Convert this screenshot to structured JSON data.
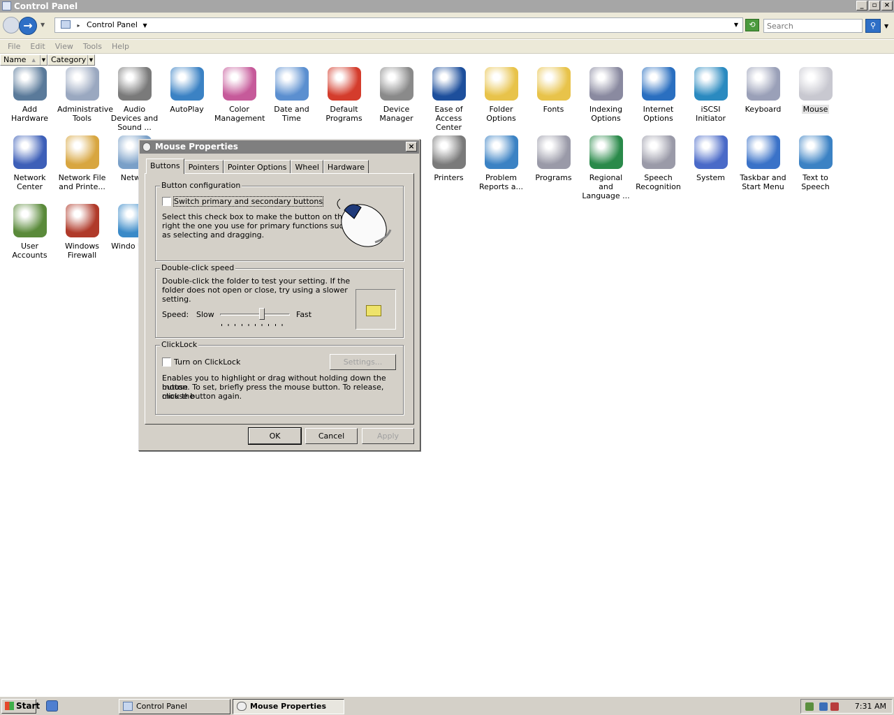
{
  "window": {
    "title": "Control Panel"
  },
  "address": {
    "location": "Control Panel",
    "search_placeholder": "Search"
  },
  "menu": [
    "File",
    "Edit",
    "View",
    "Tools",
    "Help"
  ],
  "columns": [
    "Name",
    "Category"
  ],
  "items": [
    {
      "label": "Add Hardware",
      "icon": "add-hardware-icon"
    },
    {
      "label": "Administrative Tools",
      "icon": "admin-tools-icon"
    },
    {
      "label": "Audio Devices and Sound ...",
      "icon": "speaker-icon"
    },
    {
      "label": "AutoPlay",
      "icon": "autoplay-icon"
    },
    {
      "label": "Color Management",
      "icon": "color-management-icon"
    },
    {
      "label": "Date and Time",
      "icon": "calendar-clock-icon"
    },
    {
      "label": "Default Programs",
      "icon": "default-programs-icon"
    },
    {
      "label": "Device Manager",
      "icon": "device-manager-icon"
    },
    {
      "label": "Ease of Access Center",
      "icon": "ease-of-access-icon"
    },
    {
      "label": "Folder Options",
      "icon": "folder-options-icon"
    },
    {
      "label": "Fonts",
      "icon": "fonts-folder-icon"
    },
    {
      "label": "Indexing Options",
      "icon": "indexing-icon"
    },
    {
      "label": "Internet Options",
      "icon": "globe-document-icon"
    },
    {
      "label": "iSCSI Initiator",
      "icon": "iscsi-globe-icon"
    },
    {
      "label": "Keyboard",
      "icon": "keyboard-icon"
    },
    {
      "label": "Mouse",
      "icon": "mouse-icon"
    },
    {
      "label": "Network Center",
      "icon": "network-icon"
    },
    {
      "label": "Network File and Printe...",
      "icon": "network-file-folder-icon"
    },
    {
      "label": "Networ",
      "icon": "network-list-icon"
    },
    {
      "label": "Printers",
      "icon": "printer-icon"
    },
    {
      "label": "Problem Reports a...",
      "icon": "problem-reports-icon"
    },
    {
      "label": "Programs",
      "icon": "programs-icon"
    },
    {
      "label": "Regional and Language ...",
      "icon": "regional-globe-icon"
    },
    {
      "label": "Speech Recognition",
      "icon": "microphone-icon"
    },
    {
      "label": "System",
      "icon": "system-monitor-icon"
    },
    {
      "label": "Taskbar and Start Menu",
      "icon": "taskbar-icon"
    },
    {
      "label": "Text to Speech",
      "icon": "text-to-speech-icon"
    },
    {
      "label": "User Accounts",
      "icon": "users-icon"
    },
    {
      "label": "Windows Firewall",
      "icon": "firewall-icon"
    },
    {
      "label": "Windo Upda",
      "icon": "windows-update-icon"
    }
  ],
  "dialog": {
    "title": "Mouse Properties",
    "tabs": [
      "Buttons",
      "Pointers",
      "Pointer Options",
      "Wheel",
      "Hardware"
    ],
    "button_config": {
      "title": "Button configuration",
      "checkbox_label": "Switch primary and secondary buttons",
      "description_lines": [
        "Select this check box to make the button on the",
        "right the one you use for primary functions such",
        "as selecting and dragging."
      ]
    },
    "double_click": {
      "title": "Double-click speed",
      "description_lines": [
        "Double-click the folder to test your setting. If the",
        "folder does not open or close, try using a slower",
        "setting."
      ],
      "speed_label": "Speed:",
      "slow": "Slow",
      "fast": "Fast",
      "slider_value": 0.6
    },
    "clicklock": {
      "title": "ClickLock",
      "checkbox_label": "Turn on ClickLock",
      "settings_button": "Settings...",
      "description_lines": [
        "Enables you to highlight or drag without holding down the mouse",
        "button. To set, briefly press the mouse button. To release, click the",
        "mouse button again."
      ]
    },
    "buttons": {
      "ok": "OK",
      "cancel": "Cancel",
      "apply": "Apply"
    }
  },
  "taskbar": {
    "start": "Start",
    "tasks": [
      "Control Panel",
      "Mouse Properties"
    ],
    "clock": "7:31 AM"
  }
}
